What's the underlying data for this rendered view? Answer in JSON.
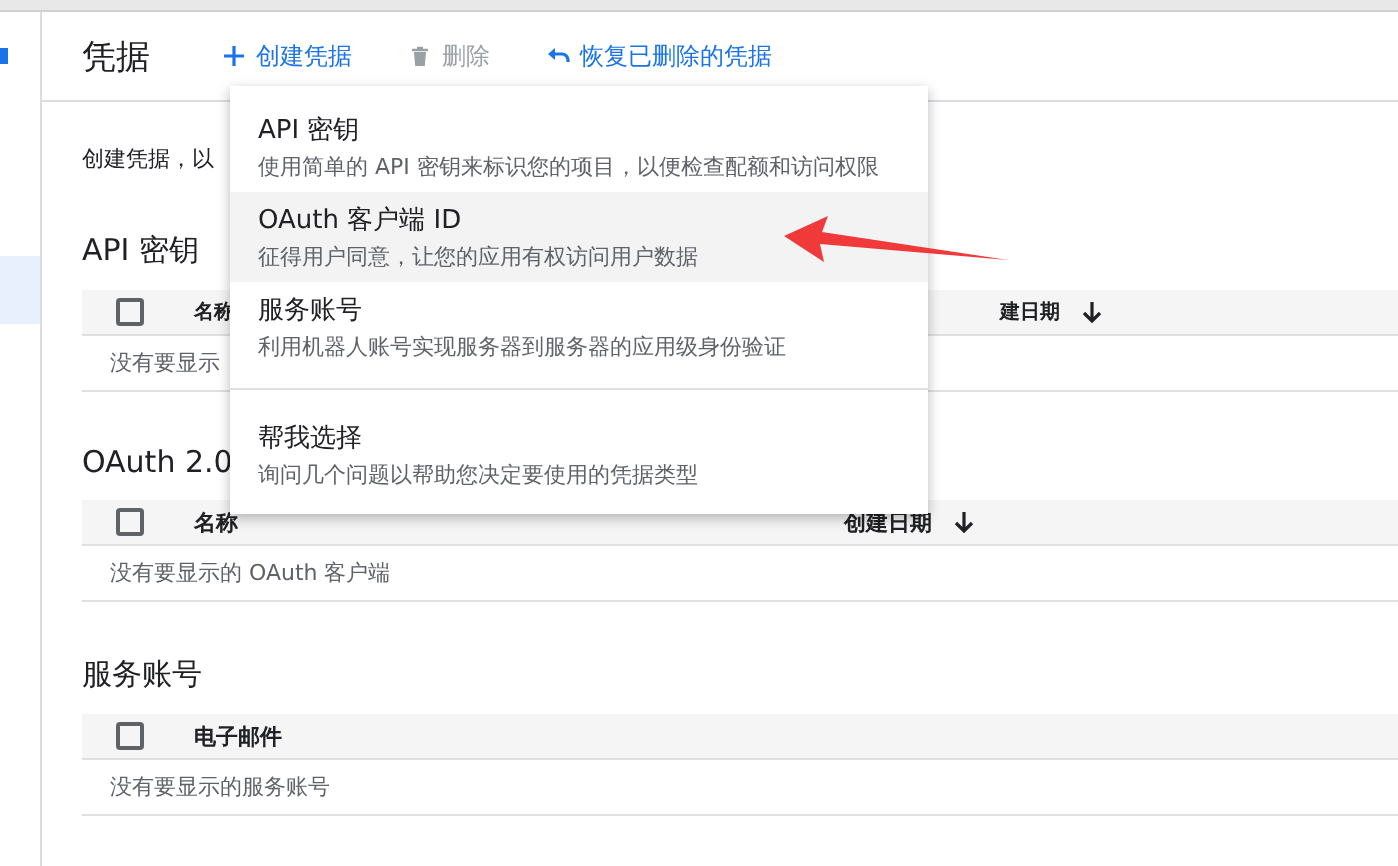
{
  "window": {
    "title": "凭据"
  },
  "sidebar": {
    "items": [
      {
        "selected": true
      }
    ]
  },
  "toolbar": [
    {
      "kind": "create",
      "label": "创建凭据",
      "disabled": false
    },
    {
      "kind": "delete",
      "label": "删除",
      "disabled": true
    },
    {
      "kind": "restore",
      "label": "恢复已删除的凭据",
      "disabled": false
    }
  ],
  "intro": "创建凭据，以",
  "sections": [
    {
      "title": "API 密钥",
      "checked": false,
      "columns": [
        {
          "label": "名称"
        },
        {
          "label": "建日期",
          "sorted": true
        }
      ],
      "empty": "没有要显示"
    },
    {
      "title": "OAuth 2.0",
      "checked": false,
      "columns": [
        {
          "label": "名称"
        },
        {
          "label": "创建日期",
          "sorted": true
        }
      ],
      "empty": "没有要显示的 OAuth 客户端"
    },
    {
      "title": "服务账号",
      "checked": false,
      "columns": [
        {
          "label": "电子邮件"
        }
      ],
      "empty": "没有要显示的服务账号"
    }
  ],
  "menu": {
    "items": [
      {
        "kind": "credential",
        "title": "API 密钥",
        "description": "使用简单的 API 密钥来标识您的项目，以便检查配额和访问权限",
        "selected": false
      },
      {
        "kind": "credential",
        "title": "OAuth 客户端 ID",
        "description": "征得用户同意，让您的应用有权访问用户数据",
        "selected": true
      },
      {
        "kind": "credential",
        "title": "服务账号",
        "description": "利用机器人账号实现服务器到服务器的应用级身份验证",
        "selected": false
      },
      {
        "kind": "help",
        "title": "帮我选择",
        "description": "询问几个问题以帮助您决定要使用的凭据类型",
        "selected": false
      }
    ]
  }
}
